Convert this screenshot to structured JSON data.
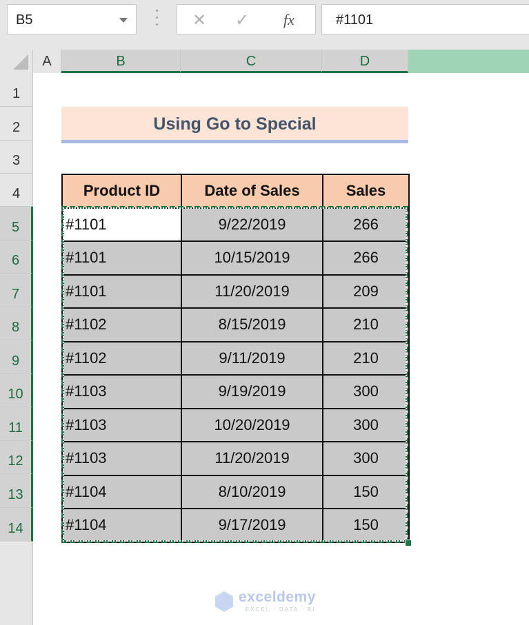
{
  "formula_bar": {
    "name_box": "B5",
    "cancel_icon": "✕",
    "enter_icon": "✓",
    "fx_label": "fx",
    "formula_value": "#1101"
  },
  "columns": [
    "A",
    "B",
    "C",
    "D"
  ],
  "rows": [
    "1",
    "2",
    "3",
    "4",
    "5",
    "6",
    "7",
    "8",
    "9",
    "10",
    "11",
    "12",
    "13",
    "14"
  ],
  "sheet": {
    "title": "Using Go to Special",
    "table": {
      "headers": [
        "Product ID",
        "Date of Sales",
        "Sales"
      ],
      "rows": [
        [
          "#1101",
          "9/22/2019",
          "266"
        ],
        [
          "#1101",
          "10/15/2019",
          "266"
        ],
        [
          "#1101",
          "11/20/2019",
          "209"
        ],
        [
          "#1102",
          "8/15/2019",
          "210"
        ],
        [
          "#1102",
          "9/11/2019",
          "210"
        ],
        [
          "#1103",
          "9/19/2019",
          "300"
        ],
        [
          "#1103",
          "10/20/2019",
          "300"
        ],
        [
          "#1103",
          "11/20/2019",
          "300"
        ],
        [
          "#1104",
          "8/10/2019",
          "150"
        ],
        [
          "#1104",
          "9/17/2019",
          "150"
        ]
      ]
    }
  },
  "watermark": {
    "name": "exceldemy",
    "tagline": "EXCEL · DATA · BI"
  },
  "colors": {
    "selection_green": "#217346",
    "header_fill": "#f8cbad",
    "title_fill": "#fce4d6",
    "selected_cell_fill": "#c9c9c9"
  }
}
